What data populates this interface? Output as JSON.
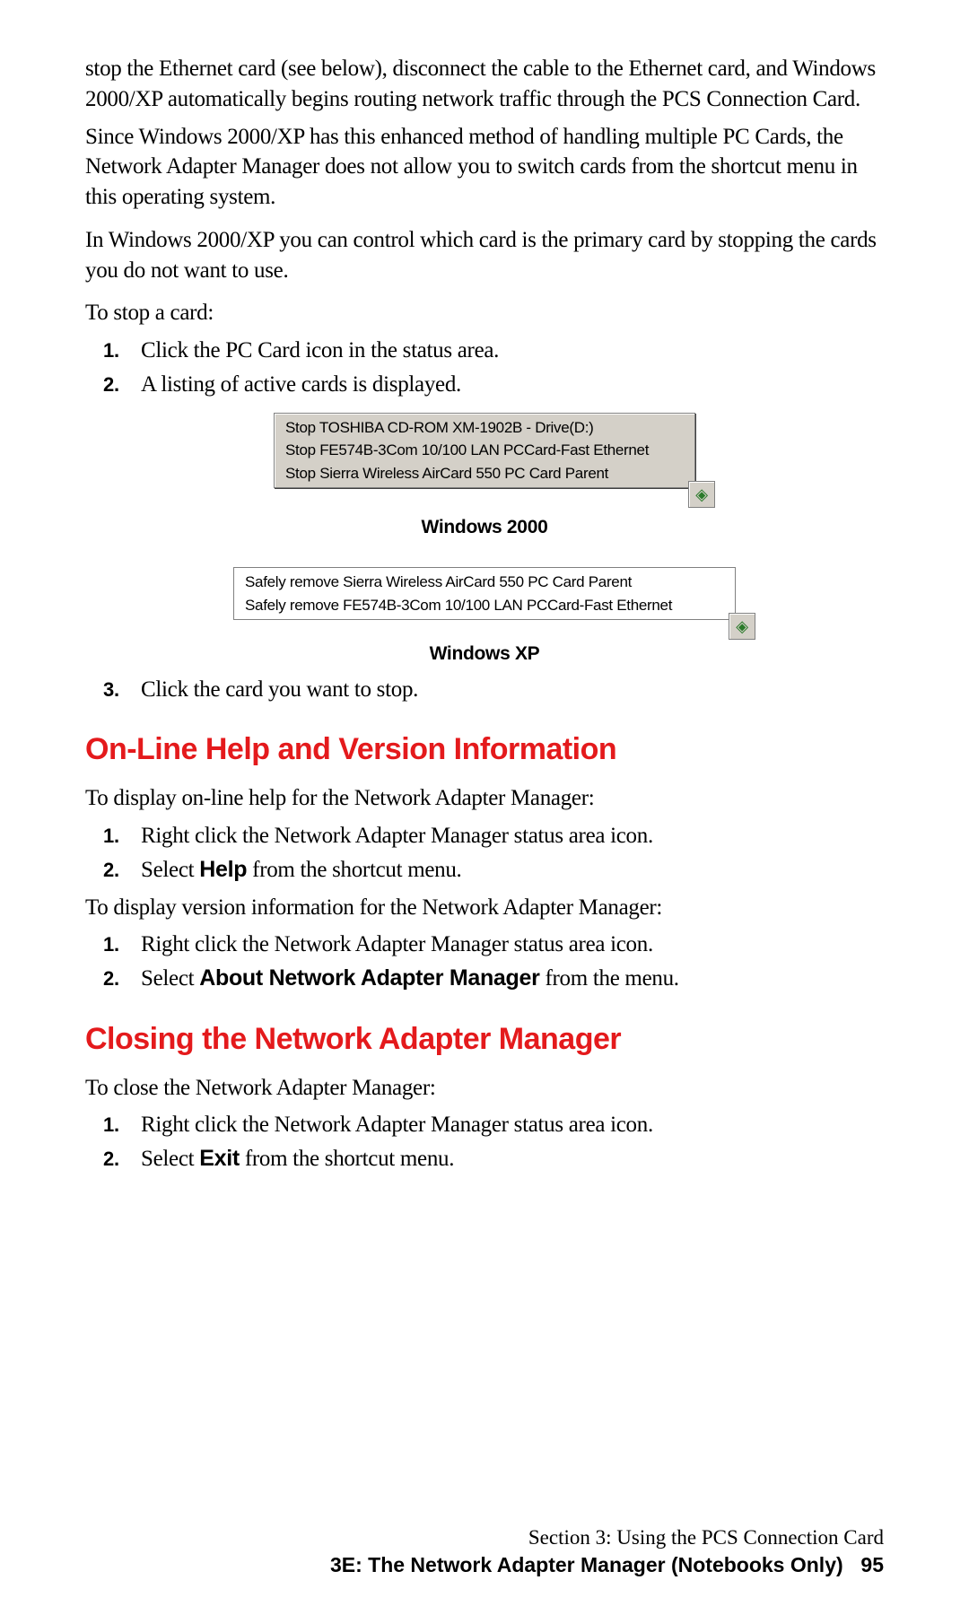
{
  "paragraphs": {
    "p1": "stop the Ethernet card (see below), disconnect the cable to the Ethernet card, and Windows 2000/XP automatically begins routing network traffic through the PCS Connection Card.",
    "p2": "Since Windows 2000/XP has this enhanced method of handling multiple PC Cards, the Network Adapter Manager does not allow you to switch cards from the shortcut menu in this operating system.",
    "p3": "In Windows 2000/XP you can control which card is the primary card by stopping the cards you do not want to use.",
    "p4": "To stop a card:"
  },
  "stop_steps": {
    "s1": "Click the PC Card icon in the status area.",
    "s2": "A listing of active cards is displayed.",
    "s3": "Click the card you want to stop."
  },
  "menu2000": {
    "line1": "Stop TOSHIBA CD-ROM XM-1902B - Drive(D:)",
    "line2": "Stop FE574B-3Com 10/100 LAN PCCard-Fast Ethernet",
    "line3": "Stop Sierra Wireless AirCard 550 PC Card Parent"
  },
  "caption2000": "Windows 2000",
  "menuXP": {
    "line1": "Safely remove Sierra Wireless AirCard 550 PC Card Parent",
    "line2": "Safely remove FE574B-3Com 10/100 LAN PCCard-Fast Ethernet"
  },
  "captionXP": "Windows XP",
  "headings": {
    "h1": "On-Line Help and Version Information",
    "h2": "Closing the Network Adapter Manager"
  },
  "help_section": {
    "intro1": "To display on-line help for the Network Adapter Manager:",
    "h1s1": "Right click the Network Adapter Manager status area icon.",
    "h1s2a": "Select ",
    "h1s2b": "Help",
    "h1s2c": " from the shortcut menu.",
    "intro2": "To display version information for the Network Adapter Manager:",
    "h2s1": "Right click the Network Adapter Manager status area icon.",
    "h2s2a": "Select ",
    "h2s2b": "About Network Adapter Manager",
    "h2s2c": " from the menu."
  },
  "close_section": {
    "intro": "To close the Network Adapter Manager:",
    "s1": "Right click the Network Adapter Manager status area icon.",
    "s2a": "Select ",
    "s2b": "Exit",
    "s2c": " from the shortcut menu."
  },
  "footer": {
    "line1": "Section 3: Using the PCS Connection Card",
    "line2": "3E: The Network Adapter Manager (Notebooks Only)",
    "page": "95"
  }
}
